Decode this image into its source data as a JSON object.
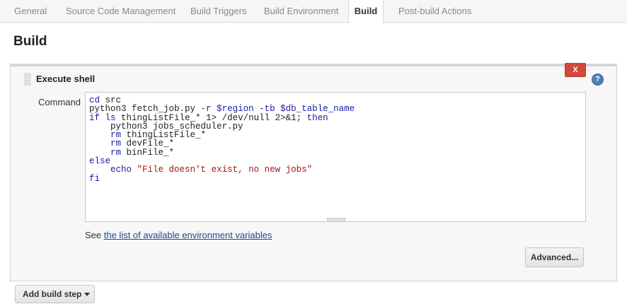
{
  "tabs": [
    {
      "label": "General"
    },
    {
      "label": "Source Code Management"
    },
    {
      "label": "Build Triggers"
    },
    {
      "label": "Build Environment"
    },
    {
      "label": "Build"
    },
    {
      "label": "Post-build Actions"
    }
  ],
  "active_tab": "Build",
  "section": {
    "title": "Build"
  },
  "step": {
    "title": "Execute shell",
    "delete_label": "X",
    "help_label": "?",
    "command_label": "Command",
    "command": "cd src\npython3 fetch_job.py -r $region -tb $db_table_name\nif ls thingListFile_* 1> /dev/null 2>&1; then\n    python3 jobs_scheduler.py\n    rm thingListFile_*\n    rm devFile_*\n    rm binFile_*\nelse\n    echo \"File doesn't exist, no new jobs\"\nfi",
    "see_prefix": "See ",
    "see_link": "the list of available environment variables",
    "advanced_label": "Advanced..."
  },
  "add_build_step_label": "Add build step",
  "colors": {
    "delete": "#d24939",
    "help": "#4f7fb5",
    "link": "#204a87",
    "keyword": "#1a1aa6",
    "string": "#a31515"
  },
  "icons": [
    "drag-handle-icon",
    "help-icon",
    "chevron-down-icon"
  ]
}
